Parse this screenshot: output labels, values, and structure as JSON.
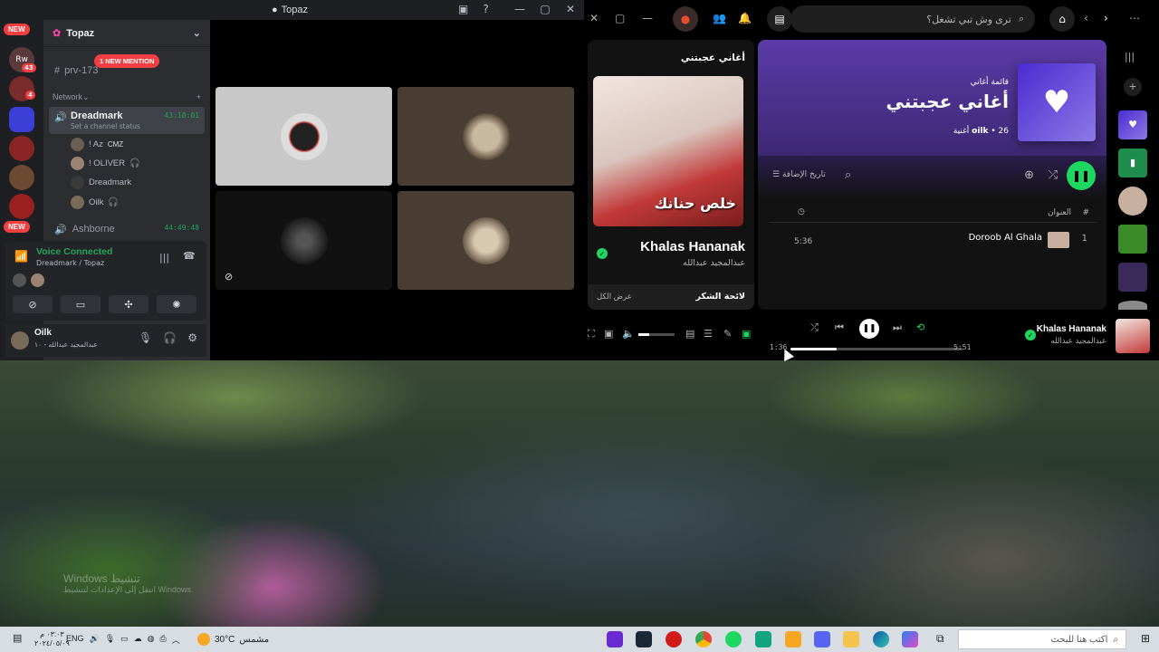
{
  "discord": {
    "window_title": "Topaz",
    "server_name": "Topaz",
    "badges": {
      "new_top": "NEW",
      "new_bottom": "NEW",
      "count_1": "43",
      "count_2": "4"
    },
    "guild_abbrev": "Rw",
    "channel_text": "prv-173",
    "new_mention": "1 NEW MENTION",
    "category": "Network",
    "voice_channel": {
      "name": "Dreadmark",
      "status": "Set a channel status",
      "timer": "43:10:01",
      "members": [
        {
          "name": "! Az",
          "extra": "CMZ"
        },
        {
          "name": "! OLIVER",
          "extra": ""
        },
        {
          "name": "Dreadmark",
          "extra": ""
        },
        {
          "name": "Oilk",
          "extra": ""
        }
      ]
    },
    "voice_channel_2": {
      "name": "Ashborne",
      "timer": "44:49:48"
    },
    "voice_panel": {
      "status": "Voice Connected",
      "sub": "Dreadmark / Topaz"
    },
    "user_panel": {
      "name": "Oilk",
      "status": "عبدالمجيد عبدالله - ١٠"
    }
  },
  "spotify": {
    "search_placeholder": "ترى وش تبي تشغل؟",
    "now_playing_panel": {
      "heading": "أغاني عجبتني",
      "art_text": "خلص حنانك",
      "track": "Khalas Hananak",
      "artist": "عبدالمجيد عبدالله",
      "credits_title": "لائحة الشكر",
      "credits_show_all": "عرض الكل"
    },
    "playlist": {
      "kind": "قائمة أغاني",
      "title": "أغاني عجبتني",
      "owner": "oilk",
      "song_count": "26 أغنية",
      "sort_label": "تاريخ الإضافة",
      "col_number": "#",
      "col_title": "العنوان",
      "rows": [
        {
          "number": "1",
          "title": "Doroob Al Ghala",
          "duration": "5:36"
        }
      ]
    },
    "player": {
      "track": "Khalas Hananak",
      "artist": "عبدالمجيد عبدالله",
      "elapsed": "1:36",
      "total": "5:51",
      "progress": 0.27,
      "volume": 0.3
    }
  },
  "desktop": {
    "watermark_title": "Windows تنشيط",
    "watermark_sub": "انتقل إلى الإعدادات لتنشيط Windows."
  },
  "taskbar": {
    "time": "٠٣:٠٣ م",
    "date": "٢٠٢٤/٠٥/٠٩",
    "language": "ENG",
    "temperature": "30°C",
    "weather": "مشمس",
    "search_placeholder": "اكتب هنا للبحث"
  }
}
